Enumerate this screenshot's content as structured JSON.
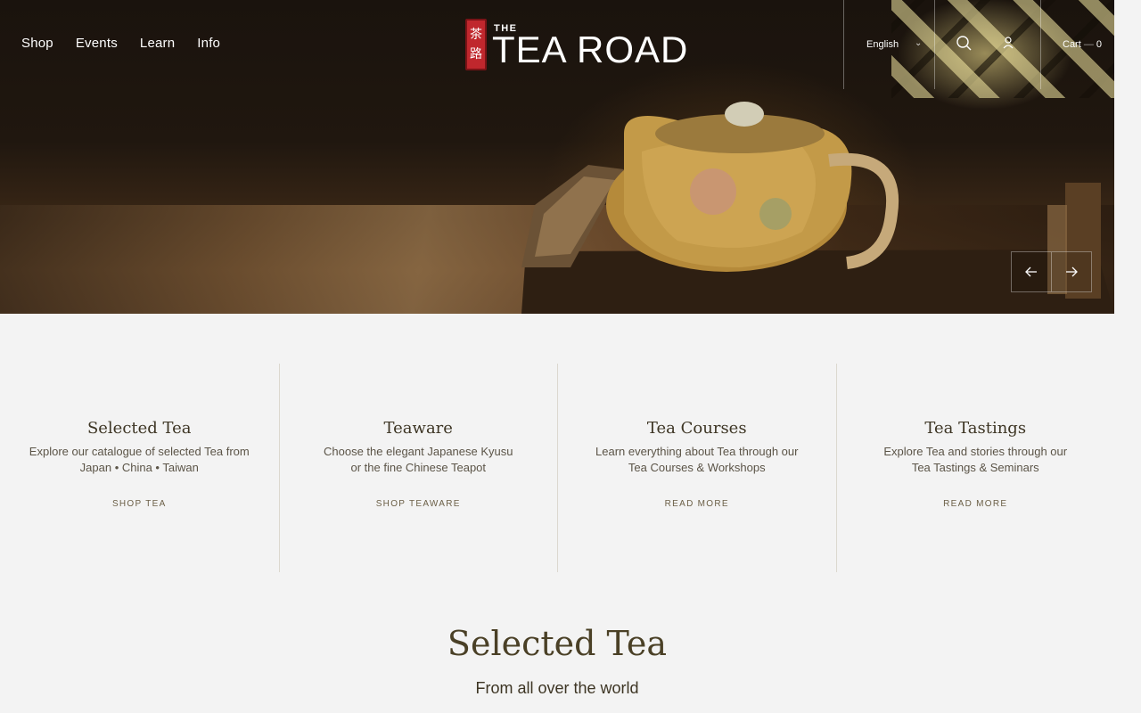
{
  "nav": {
    "items": [
      "Shop",
      "Events",
      "Learn",
      "Info"
    ]
  },
  "logo": {
    "seal_chars": "茶路",
    "the": "THE",
    "name": "TEA ROAD"
  },
  "header": {
    "language": "English",
    "cart_label": "Cart",
    "cart_separator": "—",
    "cart_count": "0",
    "icons": [
      "chevron-down-icon",
      "search-icon",
      "user-icon"
    ]
  },
  "slider": {
    "icons": [
      "arrow-left-icon",
      "arrow-right-icon"
    ]
  },
  "categories": [
    {
      "title": "Selected Tea",
      "line1": "Explore our catalogue of selected Tea from",
      "line2": "Japan • China • Taiwan",
      "link": "SHOP TEA"
    },
    {
      "title": "Teaware",
      "line1": "Choose the elegant Japanese Kyusu",
      "line2": "or the fine Chinese Teapot",
      "link": "SHOP TEAWARE"
    },
    {
      "title": "Tea Courses",
      "line1": "Learn everything about Tea through our",
      "line2": "Tea Courses & Workshops",
      "link": "READ MORE"
    },
    {
      "title": "Tea Tastings",
      "line1": "Explore Tea and stories through our",
      "line2": "Tea Tastings & Seminars",
      "link": "READ MORE"
    }
  ],
  "section": {
    "title": "Selected Tea",
    "subtitle": "From all over the world"
  },
  "colors": {
    "background": "#f3f3f3",
    "heading": "#4a4026",
    "seal_red": "#c0272d"
  }
}
